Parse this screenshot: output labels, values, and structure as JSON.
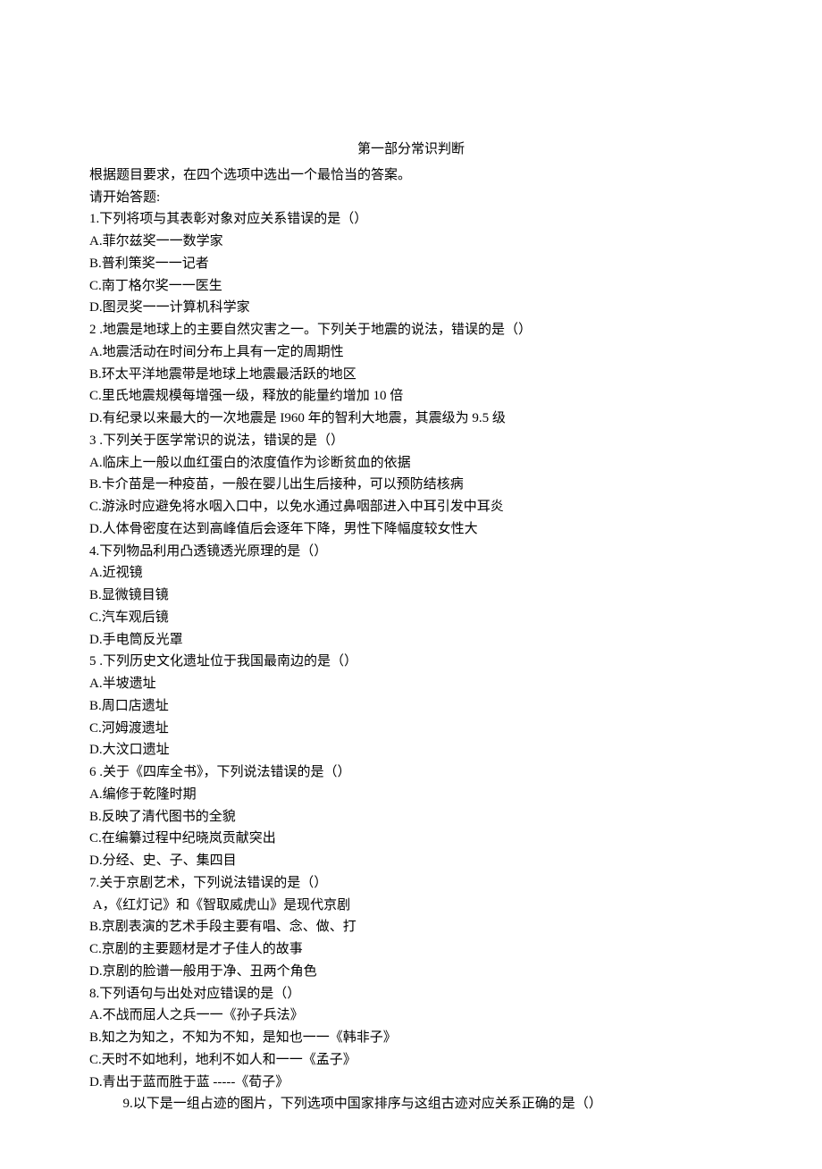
{
  "title": "第一部分常识判断",
  "intro1": "根据题目要求，在四个选项中选出一个最恰当的答案。",
  "intro2": "请开始答题:",
  "q1": {
    "stem": "1.下列将项与其表彰对象对应关系错误的是（）",
    "a": "A.菲尔兹奖一一数学家",
    "b": "B.普利策奖一一记者",
    "c": "C.南丁格尔奖一一医生",
    "d": "D.图灵奖一一计算机科学家"
  },
  "q2": {
    "stem": "2 .地震是地球上的主要自然灾害之一。下列关于地震的说法，错误的是（）",
    "a": "A.地震活动在时间分布上具有一定的周期性",
    "b": "B.环太平洋地震带是地球上地震最活跃的地区",
    "c": "C.里氏地震规模每增强一级，释放的能量约增加 10 倍",
    "d": "D.有纪录以来最大的一次地震是 I960 年的智利大地震，其震级为 9.5 级"
  },
  "q3": {
    "stem": "3 .下列关于医学常识的说法，错误的是（）",
    "a": "A.临床上一般以血红蛋白的浓度值作为诊断贫血的依据",
    "b": "B.卡介苗是一种疫苗，一般在婴儿出生后接种，可以预防结核病",
    "c": "C.游泳时应避免将水咽入口中，以免水通过鼻咽部进入中耳引发中耳炎",
    "d": "D.人体骨密度在达到高峰值后会逐年下降，男性下降幅度较女性大"
  },
  "q4": {
    "stem": "4.下列物品利用凸透镜透光原理的是（）",
    "a": "A.近视镜",
    "b": "B.显微镜目镜",
    "c": "C.汽车观后镜",
    "d": "D.手电筒反光罩"
  },
  "q5": {
    "stem": "5 .下列历史文化遗址位于我国最南边的是（）",
    "a": "A.半坡遗址",
    "b": "B.周口店遗址",
    "c": "C.河姆渡遗址",
    "d": "D.大汶口遗址"
  },
  "q6": {
    "stem": "6 .关于《四库全书》，下列说法错误的是（）",
    "a": "A.编修于乾隆时期",
    "b": "B.反映了清代图书的全貌",
    "c": "C.在编纂过程中纪晓岚贡献突出",
    "d": "D.分经、史、子、集四目"
  },
  "q7": {
    "stem": "7.关于京剧艺术，下列说法错误的是（）",
    "a": " A，《红灯记》和《智取威虎山》是现代京剧",
    "b": "B.京剧表演的艺术手段主要有唱、念、做、打",
    "c": "C.京剧的主要题材是才子佳人的故事",
    "d": "D.京剧的脸谱一般用于净、丑两个角色"
  },
  "q8": {
    "stem": "8.下列语句与出处对应错误的是（）",
    "a": "A.不战而屈人之兵一一《孙子兵法》",
    "b": "B.知之为知之，不知为不知，是知也一一《韩非子》",
    "c": "C.天时不如地利，地利不如人和一一《孟子》",
    "d": "D.青出于蓝而胜于蓝 -----《荀子》"
  },
  "q9": {
    "stem": "9.以下是一组占迹的图片，下列选项中国家排序与这组古迹对应关系正确的是（）"
  }
}
